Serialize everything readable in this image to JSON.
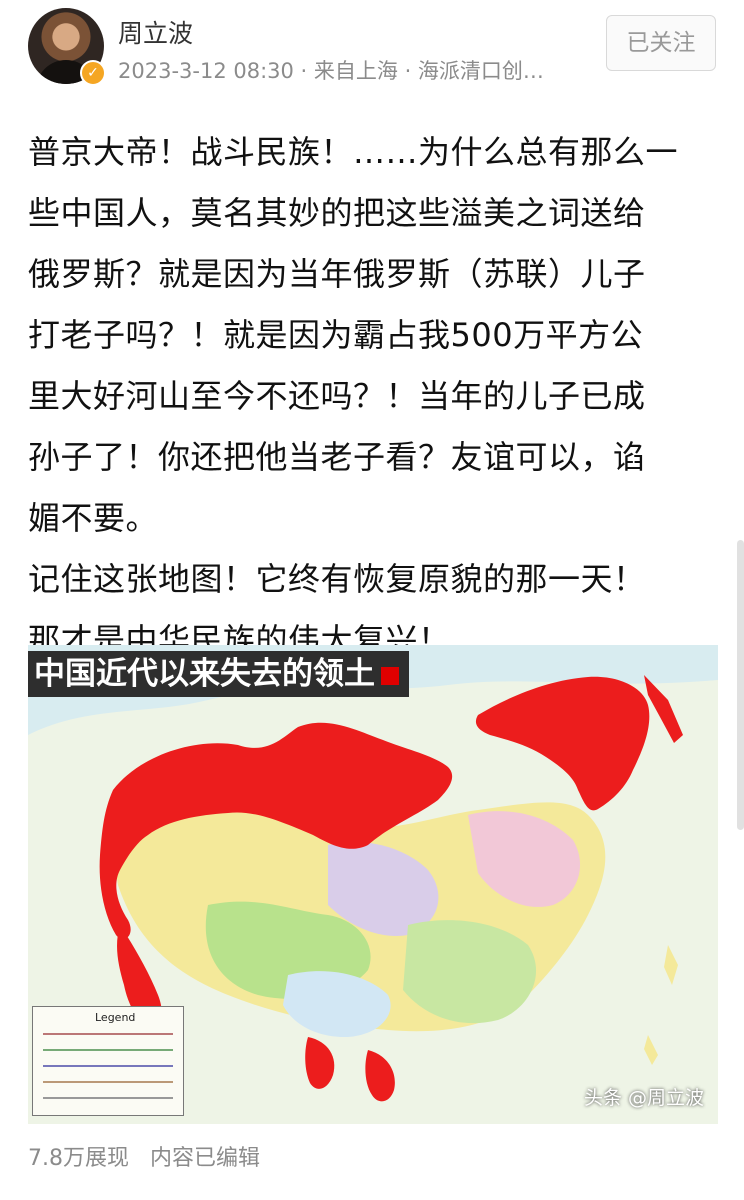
{
  "author": {
    "name": "周立波",
    "meta": "2023-3-12 08:30 · 来自上海 · 海派清口创…",
    "follow_label": "已关注"
  },
  "post": {
    "lines": [
      "普京大帝！战斗民族！……为什么总有那么一",
      "些中国人，莫名其妙的把这些溢美之词送给",
      "俄罗斯？就是因为当年俄罗斯（苏联）儿子",
      "打老子吗？！就是因为霸占我500万平方公",
      "里大好河山至今不还吗？！当年的儿子已成",
      "孙子了！你还把他当老子看？友谊可以，谄",
      "媚不要。",
      "记住这张地图！它终有恢复原貌的那一天！",
      "那才是中华民族的伟大复兴！"
    ]
  },
  "map": {
    "title": "中国近代以来失去的领土",
    "watermark": "头条 @周立波",
    "legend_heading": "Legend",
    "colors": {
      "lost_territory": "#ec1d1d",
      "sea": "#cfe7ee"
    }
  },
  "stats": {
    "views": "7.8万展现",
    "edited": "内容已编辑"
  }
}
